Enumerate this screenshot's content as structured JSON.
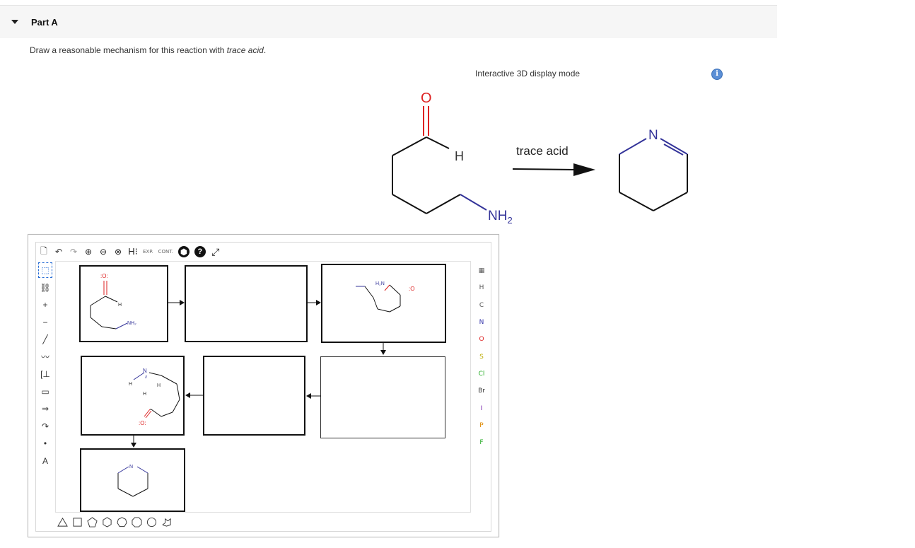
{
  "part": {
    "title": "Part A"
  },
  "question": {
    "text_before": "Draw a reasonable mechanism for this reaction with ",
    "text_emph": "trace acid",
    "text_after": "."
  },
  "display_mode": {
    "label": "Interactive 3D display mode",
    "info_icon": "info-icon"
  },
  "reaction": {
    "reagent_label": "trace acid",
    "reactant_atoms": {
      "carbonyl_o": "O",
      "aldehyde_h": "H",
      "amine": "NH",
      "amine_sub": "2"
    },
    "product_atoms": {
      "ring_n": "N"
    }
  },
  "toolbar": {
    "items": [
      {
        "name": "new-document-icon",
        "glyph": "🗋"
      },
      {
        "name": "undo-icon",
        "glyph": "↶"
      },
      {
        "name": "redo-icon",
        "glyph": "↷"
      },
      {
        "name": "zoom-in-icon",
        "glyph": "⊕"
      },
      {
        "name": "zoom-out-icon",
        "glyph": "⊖"
      },
      {
        "name": "zoom-reset-icon",
        "glyph": "⊗"
      },
      {
        "name": "hydrogens-icon",
        "glyph": "H⁝"
      },
      {
        "name": "explicit-hydrogens-icon",
        "glyph": "EXP."
      },
      {
        "name": "contract-icon",
        "glyph": "CONT."
      },
      {
        "name": "clean-icon",
        "glyph": "⬢"
      },
      {
        "name": "help-icon",
        "glyph": "?"
      },
      {
        "name": "fullscreen-icon",
        "glyph": "⤢"
      }
    ]
  },
  "left_tools": [
    {
      "name": "select-tool-icon",
      "glyph": "⬚"
    },
    {
      "name": "erase-chain-icon",
      "glyph": "⛓"
    },
    {
      "name": "charge-plus-icon",
      "glyph": "+"
    },
    {
      "name": "charge-minus-icon",
      "glyph": "−"
    },
    {
      "name": "bond-tool-icon",
      "glyph": "╱"
    },
    {
      "name": "chain-tool-icon",
      "glyph": "〰"
    },
    {
      "name": "bracket-tool-icon",
      "glyph": "[⊥"
    },
    {
      "name": "box-tool-icon",
      "glyph": "▭"
    },
    {
      "name": "reaction-arrow-icon",
      "glyph": "⇒"
    },
    {
      "name": "electron-arrow-icon",
      "glyph": "↷"
    },
    {
      "name": "lone-pair-icon",
      "glyph": "•"
    },
    {
      "name": "atom-label-icon",
      "glyph": "A"
    }
  ],
  "elements": [
    {
      "symbol": "H",
      "color": "#555555"
    },
    {
      "symbol": "C",
      "color": "#555555"
    },
    {
      "symbol": "N",
      "color": "#3333aa"
    },
    {
      "symbol": "O",
      "color": "#dd2222"
    },
    {
      "symbol": "S",
      "color": "#bbaa00"
    },
    {
      "symbol": "Cl",
      "color": "#22aa22"
    },
    {
      "symbol": "Br",
      "color": "#333333"
    },
    {
      "symbol": "I",
      "color": "#7722aa"
    },
    {
      "symbol": "P",
      "color": "#dd8800"
    },
    {
      "symbol": "F",
      "color": "#22aa22"
    }
  ],
  "element_header": "periodic-table-icon",
  "ring_templates": [
    "triangle",
    "square",
    "pentagon",
    "hexagon",
    "heptagon",
    "octagon",
    "cyclohexane",
    "benzene-chair"
  ],
  "canvas_labels": {
    "box1_o": ":O:",
    "box1_h": "H",
    "box1_nh2": "NH₂",
    "box3_h2n": "H₂N",
    "box3_o": ":O",
    "box4_h": "H",
    "box4_h2": "H",
    "box4_n": "N",
    "box4_h3": "H",
    "box4_o": ":O:",
    "box7_n": "N"
  },
  "colors": {
    "accent_blue": "#2a6fd6",
    "oxygen_red": "#dd2222",
    "nitrogen_blue": "#333399"
  }
}
